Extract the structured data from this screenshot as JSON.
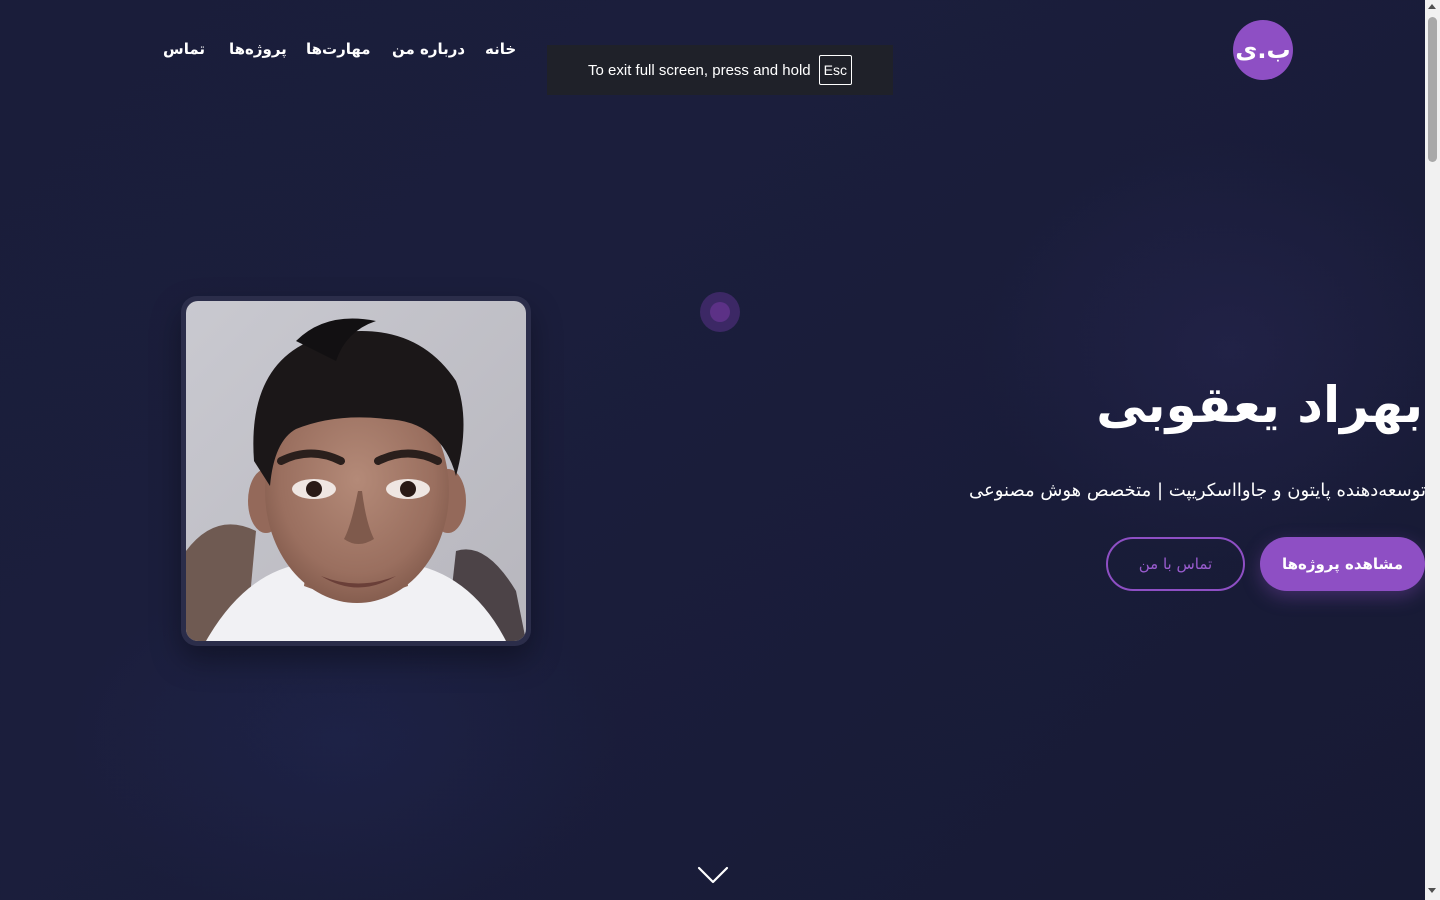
{
  "header": {
    "logo_text": "ب.ی",
    "nav": [
      {
        "label": "خانه"
      },
      {
        "label": "درباره من"
      },
      {
        "label": "مهارت‌ها"
      },
      {
        "label": "پروژه‌ها"
      },
      {
        "label": "تماس"
      }
    ]
  },
  "fullscreen_notice": {
    "message": "To exit full screen, press and hold",
    "key": "Esc"
  },
  "hero": {
    "name": "بهراد یعقوبی",
    "subtitle": "توسعه‌دهنده پایتون و جاوااسکریپت | متخصص هوش مصنوعی",
    "primary_button": "مشاهده پروژه‌ها",
    "secondary_button": "تماس با من",
    "photo_icon": "profile-photo"
  },
  "scroll_hint_icon": "chevron-down-icon",
  "colors": {
    "background": "#1a1d3a",
    "accent": "#8e4fc4",
    "text": "#ffffff",
    "notice_bg": "#1f2129"
  }
}
